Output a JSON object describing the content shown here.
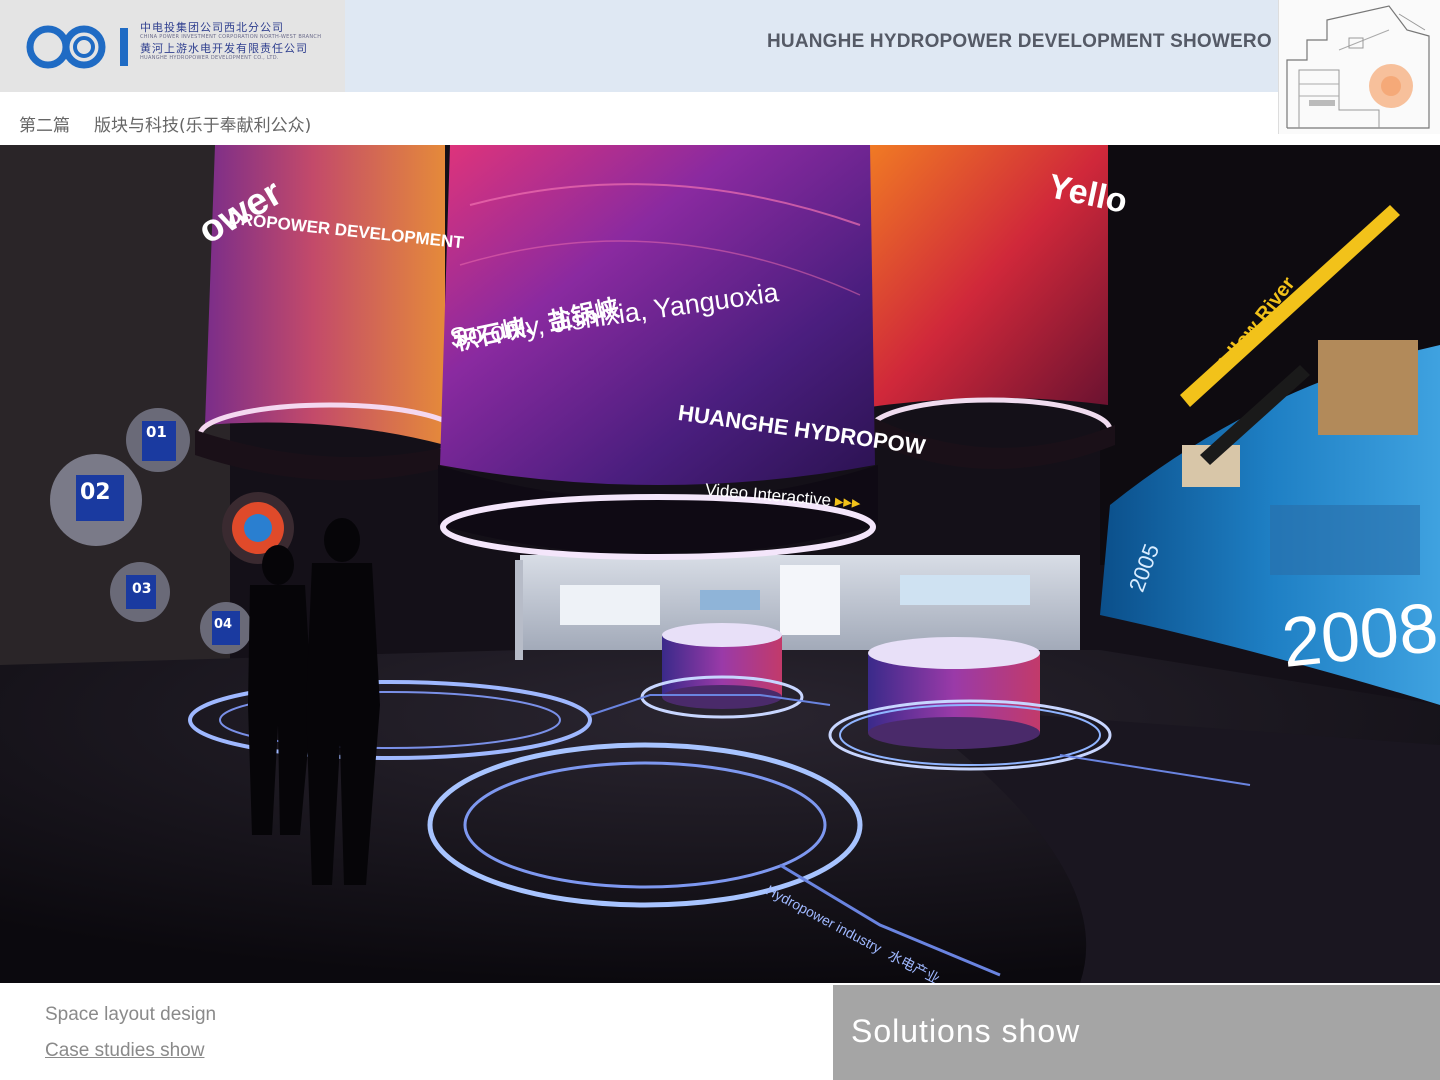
{
  "header": {
    "logo": {
      "cn_line1": "中电投集团公司西北分公司",
      "en_line1": "CHINA POWER INVESTMENT CORPORATION NORTH-WEST BRANCH",
      "cn_line2": "黄河上游水电开发有限责任公司",
      "en_line2": "HUANGHE HYDROPOWER DEVELOPMENT CO., LTD.",
      "brand_color": "#1f6bc4"
    },
    "title": "HUANGHE HYDROPOWER DEVELOPMENT SHOWERO"
  },
  "section": {
    "chapter": "第二篇",
    "subtitle": "版块与科技(乐于奉献利公众)"
  },
  "scene": {
    "left_drum_text": "DROPOWER DEVELOPMENT",
    "left_drum_big": "ower",
    "center_cn": "积石峡、盐锅峡",
    "center_en": "So only, Jishixia, Yanguoxia",
    "center_ring_text": "HUANGHE HYDROPOW",
    "video_label": "Video Interactive",
    "right_drum_text": "Yello",
    "right_wall_title": "Yellow River",
    "year_label": "2008",
    "small_year": "2005",
    "floor_text": "Hydropower industry",
    "floor_text_cn": "水电产业",
    "petal_labels": [
      "01",
      "02",
      "03",
      "04"
    ],
    "accent_colors": {
      "magenta": "#b0306c",
      "purple": "#6a2aa8",
      "orange": "#e05a1e",
      "neon_blue": "#8fb4ff",
      "wall_blue": "#1e7fc4"
    }
  },
  "footer": {
    "links": [
      "Space layout design",
      "Case studies show"
    ],
    "panel_title": "Solutions show"
  }
}
